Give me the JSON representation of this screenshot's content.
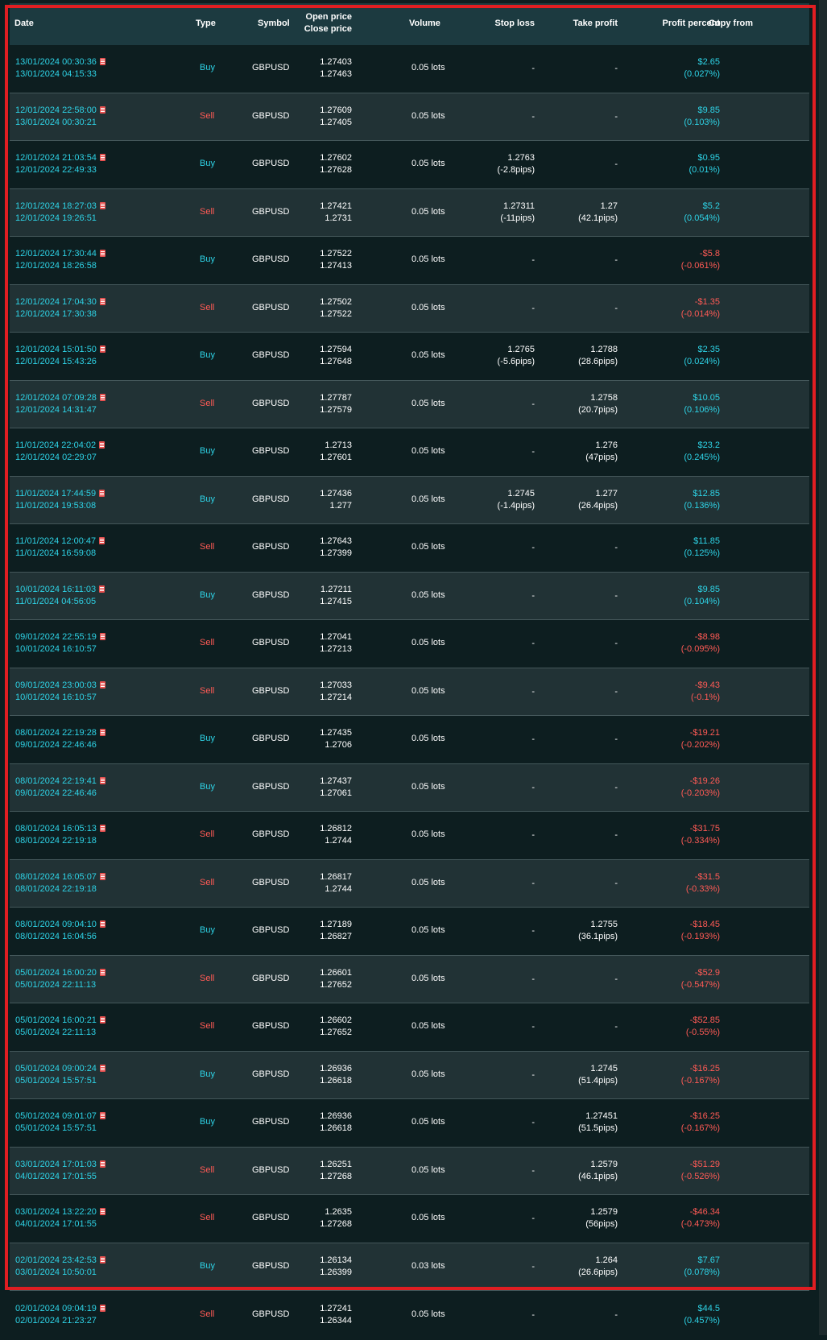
{
  "header": {
    "date": "Date",
    "type": "Type",
    "symbol": "Symbol",
    "open_price": "Open price",
    "close_price": "Close price",
    "volume": "Volume",
    "stop_loss": "Stop loss",
    "take_profit": "Take profit",
    "profit_percent": "Profit percent",
    "copy_from": "Copy from"
  },
  "colors": {
    "buy": "#2ed3e6",
    "sell": "#ff5a55",
    "header_bg": "#1c3a40",
    "row_dark": "#0d1e20",
    "row_light": "#213235",
    "highlight_border": "#e01e22"
  },
  "trades": [
    {
      "open_time": "13/01/2024 00:30:36",
      "close_time": "13/01/2024 04:15:33",
      "type": "Buy",
      "symbol": "GBPUSD",
      "open_price": "1.27403",
      "close_price": "1.27463",
      "volume": "0.05 lots",
      "sl": "-",
      "sl_pips": "",
      "tp": "-",
      "tp_pips": "",
      "profit": "$2.65",
      "profit_pct": "(0.027%)"
    },
    {
      "open_time": "12/01/2024 22:58:00",
      "close_time": "13/01/2024 00:30:21",
      "type": "Sell",
      "symbol": "GBPUSD",
      "open_price": "1.27609",
      "close_price": "1.27405",
      "volume": "0.05 lots",
      "sl": "-",
      "sl_pips": "",
      "tp": "-",
      "tp_pips": "",
      "profit": "$9.85",
      "profit_pct": "(0.103%)"
    },
    {
      "open_time": "12/01/2024 21:03:54",
      "close_time": "12/01/2024 22:49:33",
      "type": "Buy",
      "symbol": "GBPUSD",
      "open_price": "1.27602",
      "close_price": "1.27628",
      "volume": "0.05 lots",
      "sl": "1.2763",
      "sl_pips": "(-2.8pips)",
      "tp": "-",
      "tp_pips": "",
      "profit": "$0.95",
      "profit_pct": "(0.01%)"
    },
    {
      "open_time": "12/01/2024 18:27:03",
      "close_time": "12/01/2024 19:26:51",
      "type": "Sell",
      "symbol": "GBPUSD",
      "open_price": "1.27421",
      "close_price": "1.2731",
      "volume": "0.05 lots",
      "sl": "1.27311",
      "sl_pips": "(-11pips)",
      "tp": "1.27",
      "tp_pips": "(42.1pips)",
      "profit": "$5.2",
      "profit_pct": "(0.054%)"
    },
    {
      "open_time": "12/01/2024 17:30:44",
      "close_time": "12/01/2024 18:26:58",
      "type": "Buy",
      "symbol": "GBPUSD",
      "open_price": "1.27522",
      "close_price": "1.27413",
      "volume": "0.05 lots",
      "sl": "-",
      "sl_pips": "",
      "tp": "-",
      "tp_pips": "",
      "profit": "-$5.8",
      "profit_pct": "(-0.061%)"
    },
    {
      "open_time": "12/01/2024 17:04:30",
      "close_time": "12/01/2024 17:30:38",
      "type": "Sell",
      "symbol": "GBPUSD",
      "open_price": "1.27502",
      "close_price": "1.27522",
      "volume": "0.05 lots",
      "sl": "-",
      "sl_pips": "",
      "tp": "-",
      "tp_pips": "",
      "profit": "-$1.35",
      "profit_pct": "(-0.014%)"
    },
    {
      "open_time": "12/01/2024 15:01:50",
      "close_time": "12/01/2024 15:43:26",
      "type": "Buy",
      "symbol": "GBPUSD",
      "open_price": "1.27594",
      "close_price": "1.27648",
      "volume": "0.05 lots",
      "sl": "1.2765",
      "sl_pips": "(-5.6pips)",
      "tp": "1.2788",
      "tp_pips": "(28.6pips)",
      "profit": "$2.35",
      "profit_pct": "(0.024%)"
    },
    {
      "open_time": "12/01/2024 07:09:28",
      "close_time": "12/01/2024 14:31:47",
      "type": "Sell",
      "symbol": "GBPUSD",
      "open_price": "1.27787",
      "close_price": "1.27579",
      "volume": "0.05 lots",
      "sl": "-",
      "sl_pips": "",
      "tp": "1.2758",
      "tp_pips": "(20.7pips)",
      "profit": "$10.05",
      "profit_pct": "(0.106%)"
    },
    {
      "open_time": "11/01/2024 22:04:02",
      "close_time": "12/01/2024 02:29:07",
      "type": "Buy",
      "symbol": "GBPUSD",
      "open_price": "1.2713",
      "close_price": "1.27601",
      "volume": "0.05 lots",
      "sl": "-",
      "sl_pips": "",
      "tp": "1.276",
      "tp_pips": "(47pips)",
      "profit": "$23.2",
      "profit_pct": "(0.245%)"
    },
    {
      "open_time": "11/01/2024 17:44:59",
      "close_time": "11/01/2024 19:53:08",
      "type": "Buy",
      "symbol": "GBPUSD",
      "open_price": "1.27436",
      "close_price": "1.277",
      "volume": "0.05 lots",
      "sl": "1.2745",
      "sl_pips": "(-1.4pips)",
      "tp": "1.277",
      "tp_pips": "(26.4pips)",
      "profit": "$12.85",
      "profit_pct": "(0.136%)"
    },
    {
      "open_time": "11/01/2024 12:00:47",
      "close_time": "11/01/2024 16:59:08",
      "type": "Sell",
      "symbol": "GBPUSD",
      "open_price": "1.27643",
      "close_price": "1.27399",
      "volume": "0.05 lots",
      "sl": "-",
      "sl_pips": "",
      "tp": "-",
      "tp_pips": "",
      "profit": "$11.85",
      "profit_pct": "(0.125%)"
    },
    {
      "open_time": "10/01/2024 16:11:03",
      "close_time": "11/01/2024 04:56:05",
      "type": "Buy",
      "symbol": "GBPUSD",
      "open_price": "1.27211",
      "close_price": "1.27415",
      "volume": "0.05 lots",
      "sl": "-",
      "sl_pips": "",
      "tp": "-",
      "tp_pips": "",
      "profit": "$9.85",
      "profit_pct": "(0.104%)"
    },
    {
      "open_time": "09/01/2024 22:55:19",
      "close_time": "10/01/2024 16:10:57",
      "type": "Sell",
      "symbol": "GBPUSD",
      "open_price": "1.27041",
      "close_price": "1.27213",
      "volume": "0.05 lots",
      "sl": "-",
      "sl_pips": "",
      "tp": "-",
      "tp_pips": "",
      "profit": "-$8.98",
      "profit_pct": "(-0.095%)"
    },
    {
      "open_time": "09/01/2024 23:00:03",
      "close_time": "10/01/2024 16:10:57",
      "type": "Sell",
      "symbol": "GBPUSD",
      "open_price": "1.27033",
      "close_price": "1.27214",
      "volume": "0.05 lots",
      "sl": "-",
      "sl_pips": "",
      "tp": "-",
      "tp_pips": "",
      "profit": "-$9.43",
      "profit_pct": "(-0.1%)"
    },
    {
      "open_time": "08/01/2024 22:19:28",
      "close_time": "09/01/2024 22:46:46",
      "type": "Buy",
      "symbol": "GBPUSD",
      "open_price": "1.27435",
      "close_price": "1.2706",
      "volume": "0.05 lots",
      "sl": "-",
      "sl_pips": "",
      "tp": "-",
      "tp_pips": "",
      "profit": "-$19.21",
      "profit_pct": "(-0.202%)"
    },
    {
      "open_time": "08/01/2024 22:19:41",
      "close_time": "09/01/2024 22:46:46",
      "type": "Buy",
      "symbol": "GBPUSD",
      "open_price": "1.27437",
      "close_price": "1.27061",
      "volume": "0.05 lots",
      "sl": "-",
      "sl_pips": "",
      "tp": "-",
      "tp_pips": "",
      "profit": "-$19.26",
      "profit_pct": "(-0.203%)"
    },
    {
      "open_time": "08/01/2024 16:05:13",
      "close_time": "08/01/2024 22:19:18",
      "type": "Sell",
      "symbol": "GBPUSD",
      "open_price": "1.26812",
      "close_price": "1.2744",
      "volume": "0.05 lots",
      "sl": "-",
      "sl_pips": "",
      "tp": "-",
      "tp_pips": "",
      "profit": "-$31.75",
      "profit_pct": "(-0.334%)"
    },
    {
      "open_time": "08/01/2024 16:05:07",
      "close_time": "08/01/2024 22:19:18",
      "type": "Sell",
      "symbol": "GBPUSD",
      "open_price": "1.26817",
      "close_price": "1.2744",
      "volume": "0.05 lots",
      "sl": "-",
      "sl_pips": "",
      "tp": "-",
      "tp_pips": "",
      "profit": "-$31.5",
      "profit_pct": "(-0.33%)"
    },
    {
      "open_time": "08/01/2024 09:04:10",
      "close_time": "08/01/2024 16:04:56",
      "type": "Buy",
      "symbol": "GBPUSD",
      "open_price": "1.27189",
      "close_price": "1.26827",
      "volume": "0.05 lots",
      "sl": "-",
      "sl_pips": "",
      "tp": "1.2755",
      "tp_pips": "(36.1pips)",
      "profit": "-$18.45",
      "profit_pct": "(-0.193%)"
    },
    {
      "open_time": "05/01/2024 16:00:20",
      "close_time": "05/01/2024 22:11:13",
      "type": "Sell",
      "symbol": "GBPUSD",
      "open_price": "1.26601",
      "close_price": "1.27652",
      "volume": "0.05 lots",
      "sl": "-",
      "sl_pips": "",
      "tp": "-",
      "tp_pips": "",
      "profit": "-$52.9",
      "profit_pct": "(-0.547%)"
    },
    {
      "open_time": "05/01/2024 16:00:21",
      "close_time": "05/01/2024 22:11:13",
      "type": "Sell",
      "symbol": "GBPUSD",
      "open_price": "1.26602",
      "close_price": "1.27652",
      "volume": "0.05 lots",
      "sl": "-",
      "sl_pips": "",
      "tp": "-",
      "tp_pips": "",
      "profit": "-$52.85",
      "profit_pct": "(-0.55%)"
    },
    {
      "open_time": "05/01/2024 09:00:24",
      "close_time": "05/01/2024 15:57:51",
      "type": "Buy",
      "symbol": "GBPUSD",
      "open_price": "1.26936",
      "close_price": "1.26618",
      "volume": "0.05 lots",
      "sl": "-",
      "sl_pips": "",
      "tp": "1.2745",
      "tp_pips": "(51.4pips)",
      "profit": "-$16.25",
      "profit_pct": "(-0.167%)"
    },
    {
      "open_time": "05/01/2024 09:01:07",
      "close_time": "05/01/2024 15:57:51",
      "type": "Buy",
      "symbol": "GBPUSD",
      "open_price": "1.26936",
      "close_price": "1.26618",
      "volume": "0.05 lots",
      "sl": "-",
      "sl_pips": "",
      "tp": "1.27451",
      "tp_pips": "(51.5pips)",
      "profit": "-$16.25",
      "profit_pct": "(-0.167%)"
    },
    {
      "open_time": "03/01/2024 17:01:03",
      "close_time": "04/01/2024 17:01:55",
      "type": "Sell",
      "symbol": "GBPUSD",
      "open_price": "1.26251",
      "close_price": "1.27268",
      "volume": "0.05 lots",
      "sl": "-",
      "sl_pips": "",
      "tp": "1.2579",
      "tp_pips": "(46.1pips)",
      "profit": "-$51.29",
      "profit_pct": "(-0.526%)"
    },
    {
      "open_time": "03/01/2024 13:22:20",
      "close_time": "04/01/2024 17:01:55",
      "type": "Sell",
      "symbol": "GBPUSD",
      "open_price": "1.2635",
      "close_price": "1.27268",
      "volume": "0.05 lots",
      "sl": "-",
      "sl_pips": "",
      "tp": "1.2579",
      "tp_pips": "(56pips)",
      "profit": "-$46.34",
      "profit_pct": "(-0.473%)"
    },
    {
      "open_time": "02/01/2024 23:42:53",
      "close_time": "03/01/2024 10:50:01",
      "type": "Buy",
      "symbol": "GBPUSD",
      "open_price": "1.26134",
      "close_price": "1.26399",
      "volume": "0.03 lots",
      "sl": "-",
      "sl_pips": "",
      "tp": "1.264",
      "tp_pips": "(26.6pips)",
      "profit": "$7.67",
      "profit_pct": "(0.078%)"
    },
    {
      "open_time": "02/01/2024 09:04:19",
      "close_time": "02/01/2024 21:23:27",
      "type": "Sell",
      "symbol": "GBPUSD",
      "open_price": "1.27241",
      "close_price": "1.26344",
      "volume": "0.05 lots",
      "sl": "-",
      "sl_pips": "",
      "tp": "-",
      "tp_pips": "",
      "profit": "$44.5",
      "profit_pct": "(0.457%)"
    }
  ]
}
